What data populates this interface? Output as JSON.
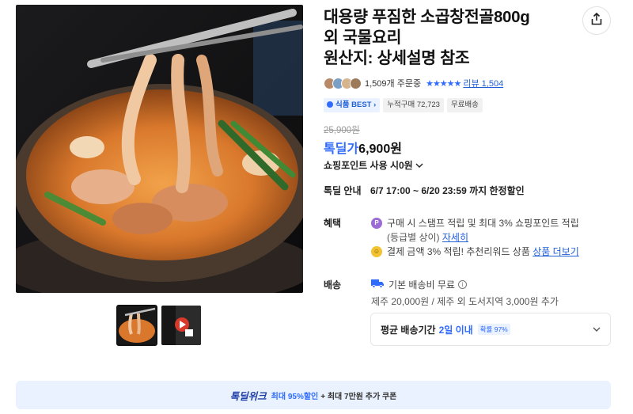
{
  "product": {
    "title_line1": "대용량 푸짐한 소곱창전골800g",
    "title_line2": "외 국물요리",
    "title_line3": "원산지: 상세설명 참조"
  },
  "rating": {
    "orders": "1,509개 주문중",
    "stars": "★★★★★",
    "review_label": "리뷰 1,504"
  },
  "tags": [
    "식품 BEST",
    "누적구매 72,723",
    "무료배송"
  ],
  "price": {
    "original": "25,900원",
    "deal_label": "톡딜가",
    "deal_price": "6,900원",
    "points_text": "쇼핑포인트 사용 시0원"
  },
  "deal_info": {
    "label": "톡딜 안내",
    "period": "6/7 17:00 ~ 6/20 23:59 까지 한정할인"
  },
  "benefit": {
    "label": "혜택",
    "line1": "구매 시 스탬프 적립 및 최대 3% 쇼핑포인트 적립",
    "line1_sub": "(등급별 상이)",
    "line1_link": "자세히",
    "line2": "결제 금액 3% 적립! 추천리워드 상품",
    "line2_link": "상품 더보기"
  },
  "shipping": {
    "label": "배송",
    "base": "기본 배송비 무료",
    "extra": "제주 20,000원 / 제주 외 도서지역 3,000원 추가",
    "avg_label": "평균 배송기간",
    "avg_days": "2일 이내",
    "avg_pct": "확률 97%"
  },
  "banner": {
    "brand": "톡딜위크",
    "highlight": "최대 95%할인",
    "rest": "+ 최대 7만원 추가 쿠폰"
  },
  "icons": {
    "share": "share-icon",
    "stamp_coin": "P",
    "reward_coin": "smile"
  },
  "colors": {
    "accent": "#2f6bff",
    "link": "#1f5fd6",
    "banner_bg": "#eaf2ff"
  }
}
